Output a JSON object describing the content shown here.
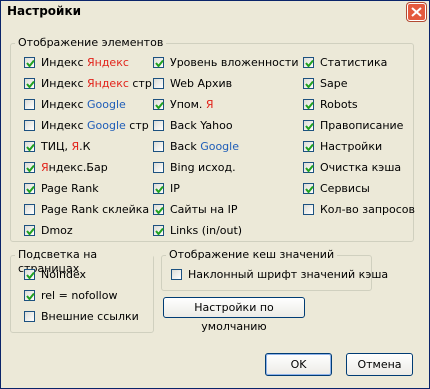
{
  "window": {
    "title": "Настройки"
  },
  "elements_group": {
    "legend": "Отображение элементов",
    "col1": [
      {
        "label": "Индекс ",
        "brand": "Яндекс",
        "tail": "",
        "brand_color": "red",
        "checked": true
      },
      {
        "label": "Индекс ",
        "brand": "Яндекс",
        "tail": " стр",
        "brand_color": "red",
        "checked": true
      },
      {
        "label": "Индекс ",
        "brand": "Google",
        "tail": "",
        "brand_color": "blue",
        "checked": false
      },
      {
        "label": "Индекс ",
        "brand": "Google",
        "tail": " стр",
        "brand_color": "blue",
        "checked": false
      },
      {
        "label": "ТИЦ, ",
        "brand": "Я",
        "tail": ".К",
        "brand_color": "red",
        "checked": true
      },
      {
        "label": "",
        "brand": "Я",
        "tail": "ндекс.Бар",
        "brand_color": "red",
        "checked": true
      },
      {
        "label": "Page Rank",
        "brand": "",
        "tail": "",
        "brand_color": "",
        "checked": true
      },
      {
        "label": "Page Rank склейка",
        "brand": "",
        "tail": "",
        "brand_color": "",
        "checked": false
      },
      {
        "label": "Dmoz",
        "brand": "",
        "tail": "",
        "brand_color": "",
        "checked": true
      }
    ],
    "col2": [
      {
        "label": "Уровень вложенности",
        "brand": "",
        "tail": "",
        "brand_color": "",
        "checked": true
      },
      {
        "label": "Web Архив",
        "brand": "",
        "tail": "",
        "brand_color": "",
        "checked": false
      },
      {
        "label": "Упом. ",
        "brand": "Я",
        "tail": "",
        "brand_color": "red",
        "checked": true
      },
      {
        "label": "Back Yahoo",
        "brand": "",
        "tail": "",
        "brand_color": "",
        "checked": false
      },
      {
        "label": "Back ",
        "brand": "Google",
        "tail": "",
        "brand_color": "blue",
        "checked": false
      },
      {
        "label": "Bing исход.",
        "brand": "",
        "tail": "",
        "brand_color": "",
        "checked": false
      },
      {
        "label": "IP",
        "brand": "",
        "tail": "",
        "brand_color": "",
        "checked": true
      },
      {
        "label": "Сайты на IP",
        "brand": "",
        "tail": "",
        "brand_color": "",
        "checked": true
      },
      {
        "label": "Links (in/out)",
        "brand": "",
        "tail": "",
        "brand_color": "",
        "checked": true
      }
    ],
    "col3": [
      {
        "label": "Статистика",
        "checked": true
      },
      {
        "label": "Sape",
        "checked": true
      },
      {
        "label": "Robots",
        "checked": true
      },
      {
        "label": "Правописание",
        "checked": true
      },
      {
        "label": "Настройки",
        "checked": true
      },
      {
        "label": "Очистка кэша",
        "checked": true
      },
      {
        "label": "Сервисы",
        "checked": true
      },
      {
        "label": "Кол-во запросов",
        "checked": false
      }
    ]
  },
  "highlight_group": {
    "legend": "Подсветка на страницах",
    "items": [
      {
        "label": "Noindex",
        "checked": true
      },
      {
        "label": "rel = nofollow",
        "checked": true
      },
      {
        "label": "Внешние ссылки",
        "checked": false
      }
    ]
  },
  "cache_group": {
    "legend": "Отображение кеш значений",
    "items": [
      {
        "label": "Наклонный шрифт значений кэша",
        "checked": false
      }
    ]
  },
  "buttons": {
    "defaults": "Настройки по умолчанию",
    "ok": "OK",
    "cancel": "Отмена"
  }
}
